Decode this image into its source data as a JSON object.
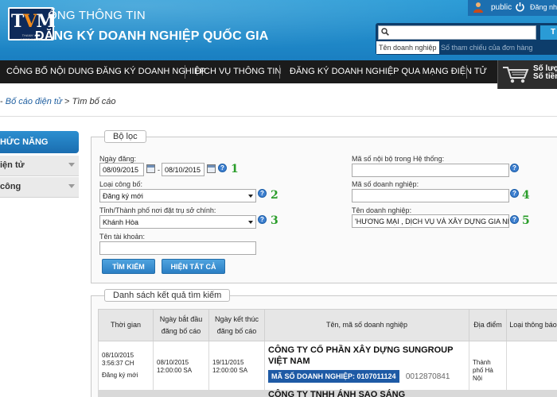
{
  "header": {
    "logo_text": "TVM",
    "logo_caption": "THANH VAN ACCOUNTING",
    "portal_small": "ỔNG THÔNG TIN",
    "portal_big": "ĐĂNG KÝ DOANH NGHIỆP QUỐC GIA",
    "user": "public",
    "login": "Đăng nh",
    "search": {
      "placeholder": "",
      "button_label": "T",
      "tab_name": "Tên doanh nghiệp",
      "tab_ref": "Số tham chiếu của đơn hàng"
    }
  },
  "nav": {
    "items": [
      "CÔNG BỐ NỘI DUNG ĐĂNG KÝ DOANH NGHIỆP",
      "DỊCH VỤ THÔNG TIN",
      "ĐĂNG KÝ DOANH NGHIỆP QUA MẠNG ĐIỆN TỬ"
    ],
    "cart_line1": "Số lượ",
    "cart_line2": "Số tiền"
  },
  "breadcrumb": {
    "prefix": "-",
    "link": "Bố cáo điện tử",
    "separator": ">",
    "current": "Tìm bố cáo"
  },
  "sidebar": {
    "title": "HỨC NĂNG",
    "items": [
      "iện tử",
      "công"
    ]
  },
  "filter": {
    "legend": "Bộ lọc",
    "date_label": "Ngày đăng:",
    "date_from": "08/09/2015",
    "date_sep": "-",
    "date_to": "08/10/2015",
    "type_label": "Loại công bố:",
    "type_value": "Đăng ký mới",
    "province_label": "Tỉnh/Thành phố nơi đặt trụ sở chính:",
    "province_value": "Khánh Hòa",
    "account_label": "Tên tài khoản:",
    "account_value": "",
    "internal_id_label": "Mã số nội bộ trong Hệ thống:",
    "internal_id_value": "",
    "tax_id_label": "Mã số doanh nghiệp:",
    "tax_id_value": "",
    "company_label": "Tên doanh nghiệp:",
    "company_value": "'HƯƠNG MẠI , DỊCH VỤ VÀ XÂY DỰNG GIA NHẤT",
    "search_button": "TÌM KIẾM",
    "show_all_button": "HIỆN TẤT CẢ",
    "annotations": [
      "1",
      "2",
      "3",
      "4",
      "5"
    ]
  },
  "results": {
    "legend": "Danh sách kết quả tìm kiếm",
    "headers": [
      "Thời gian",
      "Ngày bắt đầu đăng bố cáo",
      "Ngày kết thúc đăng bố cáo",
      "Tên, mã số doanh nghiệp",
      "Địa điểm",
      "Loại thông báo"
    ],
    "rows": [
      {
        "time_date": "08/10/2015",
        "time_clock": "3:56:37 CH",
        "time_type": "Đăng ký mới",
        "start": "08/10/2015 12:00:00 SA",
        "end": "19/11/2015 12:00:00 SA",
        "company": "CÔNG TY CỔ PHẦN XÂY DỰNG SUNGROUP VIỆT NAM",
        "msdn": "MÃ SỐ DOANH NGHIỆP: 0107011124",
        "old_code": "0012870841",
        "location": "Thành phố Hà Nội",
        "notice_type": ""
      },
      {
        "company": "CÔNG TY TNHH ÁNH SAO SÁNG"
      }
    ]
  },
  "colors": {
    "header_blue": "#1a7fc1",
    "nav_black": "#1b1b1b",
    "button_blue": "#2b7fc4",
    "annotation_green": "#2a9d2a",
    "badge_blue": "#1e5aa5"
  }
}
